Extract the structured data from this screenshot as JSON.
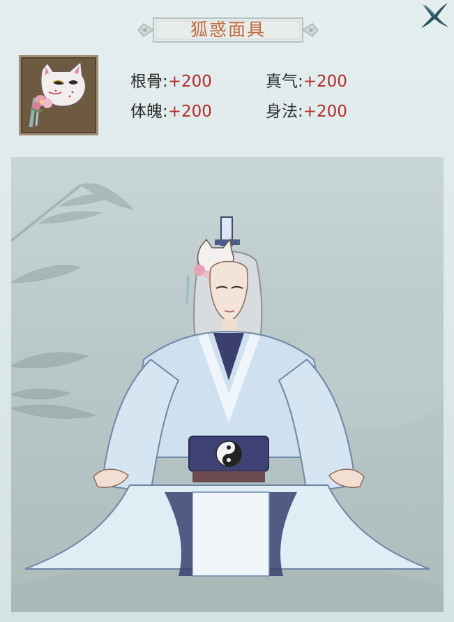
{
  "item": {
    "name": "狐惑面具",
    "icon": "fox-mask-icon"
  },
  "stats": [
    {
      "label": "根骨:",
      "value": "+200"
    },
    {
      "label": "真气:",
      "value": "+200"
    },
    {
      "label": "体魄:",
      "value": "+200"
    },
    {
      "label": "身法:",
      "value": "+200"
    }
  ],
  "close": {
    "icon": "close-icon"
  },
  "colors": {
    "title": "#c26a3c",
    "stat_value": "#b52a2a",
    "background": "#dfe9ea"
  }
}
